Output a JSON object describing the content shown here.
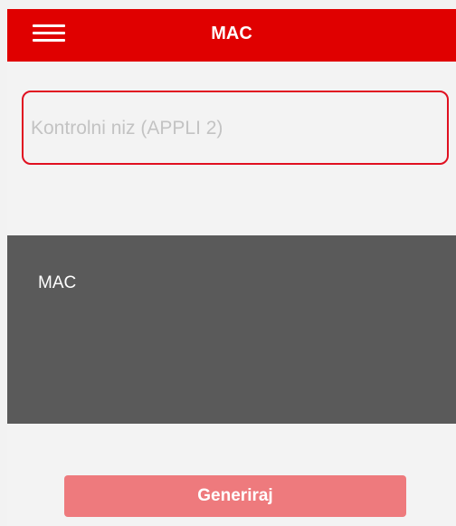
{
  "header": {
    "title": "MAC",
    "menu_icon": "hamburger-menu-icon",
    "background_color": "#e00000"
  },
  "input": {
    "value": "",
    "placeholder": "Kontrolni niz (APPLI 2)",
    "border_color": "#e01020"
  },
  "result": {
    "label": "MAC",
    "background_color": "#5a5a5a"
  },
  "actions": {
    "generate_label": "Generiraj",
    "generate_color": "#ee7a7d"
  }
}
